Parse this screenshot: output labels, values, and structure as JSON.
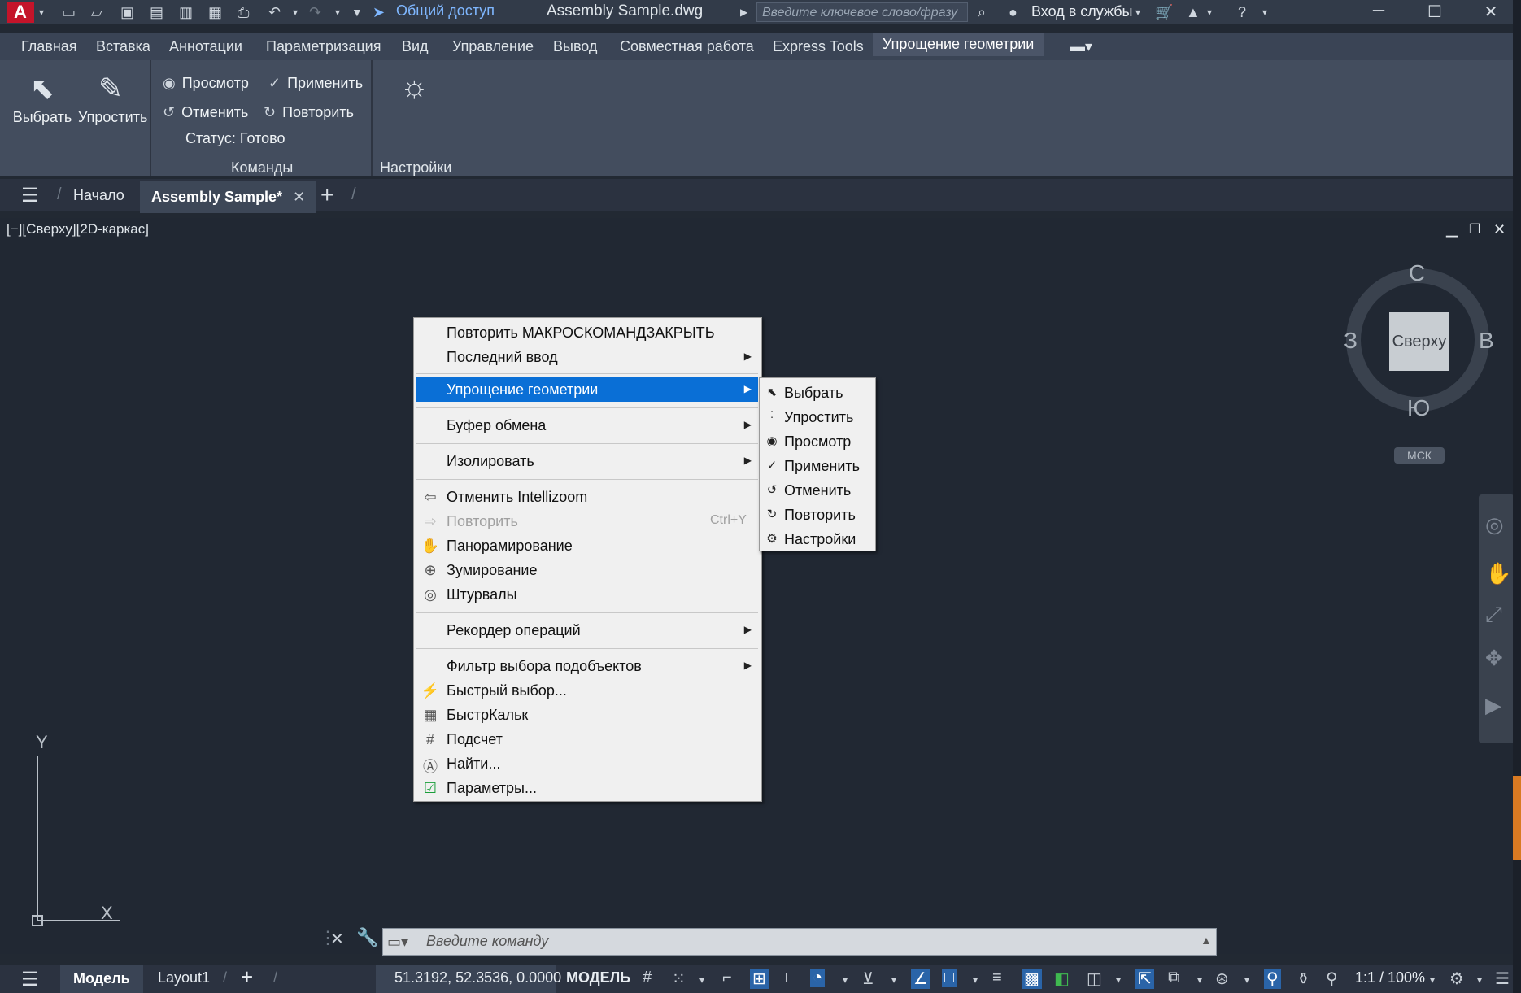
{
  "titlebar": {
    "logo": "A",
    "share_label": "Общий доступ",
    "doc_title": "Assembly Sample.dwg",
    "search_placeholder": "Введите ключевое слово/фразу",
    "login_label": "Вход в службы"
  },
  "ribbon_tabs": [
    "Главная",
    "Вставка",
    "Аннотации",
    "Параметризация",
    "Вид",
    "Управление",
    "Вывод",
    "Совместная работа",
    "Express Tools",
    "Упрощение геометрии"
  ],
  "ribbon": {
    "select_label": "Выбрать",
    "simplify_label": "Упростить",
    "preview_label": "Просмотр",
    "apply_label": "Применить",
    "undo_label": "Отменить",
    "redo_label": "Повторить",
    "status_label": "Статус: Готово",
    "group_commands": "Команды",
    "group_settings": "Настройки"
  },
  "doc_tabs": {
    "start": "Начало",
    "active": "Assembly Sample*"
  },
  "viewport": {
    "label": "[−][Сверху][2D-каркас]",
    "viewcube": {
      "top": "Сверху",
      "north": "С",
      "south": "Ю",
      "west": "З",
      "east": "В",
      "ucs": "МСК"
    }
  },
  "context_menu": {
    "repeat": "Повторить МАКРОСКОМАНДЗАКРЫТЬ",
    "last_input": "Последний ввод",
    "simplify_geometry": "Упрощение геометрии",
    "clipboard": "Буфер обмена",
    "isolate": "Изолировать",
    "undo_intellizoom": "Отменить Intellizoom",
    "redo": "Повторить",
    "redo_shortcut": "Ctrl+Y",
    "pan": "Панорамирование",
    "zoom": "Зумирование",
    "steeringwheels": "Штурвалы",
    "action_recorder": "Рекордер операций",
    "subobject_filter": "Фильтр выбора подобъектов",
    "quick_select": "Быстрый выбор...",
    "quickcalc": "БыстрКальк",
    "count": "Подсчет",
    "find": "Найти...",
    "options": "Параметры..."
  },
  "submenu": [
    "Выбрать",
    "Упростить",
    "Просмотр",
    "Применить",
    "Отменить",
    "Повторить",
    "Настройки"
  ],
  "command_line": {
    "placeholder": "Введите команду"
  },
  "status_bar": {
    "model_tab": "Модель",
    "layout_tab": "Layout1",
    "coords": "51.3192, 52.3536, 0.0000",
    "space": "МОДЕЛЬ",
    "scale": "1:1 / 100%"
  },
  "ucs": {
    "y": "Y",
    "x": "X"
  }
}
